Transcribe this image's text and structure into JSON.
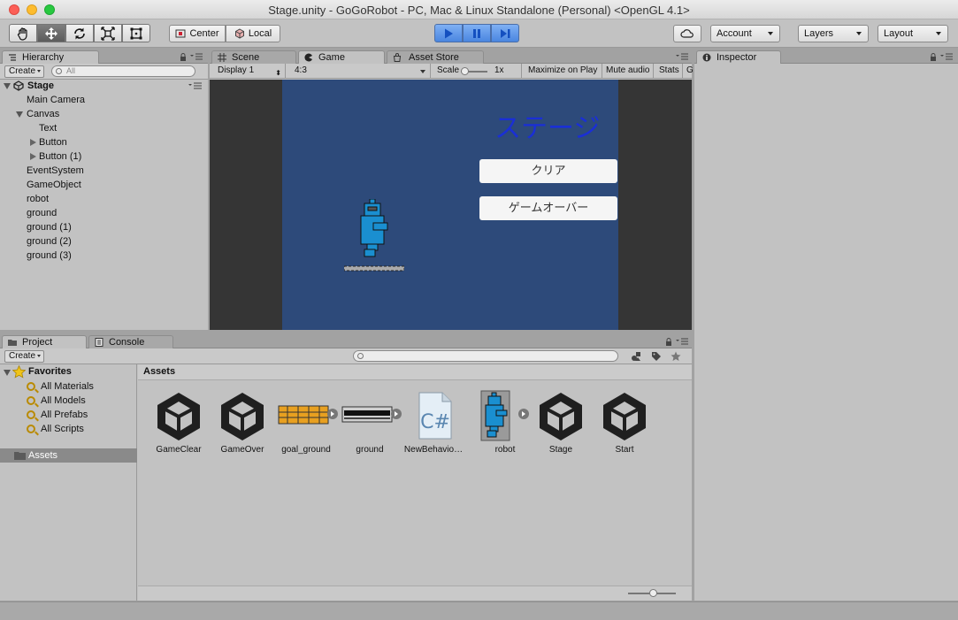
{
  "window": {
    "title": "Stage.unity - GoGoRobot - PC, Mac & Linux Standalone (Personal) <OpenGL 4.1>"
  },
  "toolbar": {
    "tools": [
      "hand-tool",
      "move-tool",
      "rotate-tool",
      "scale-tool",
      "rect-tool"
    ],
    "pivot_center": "Center",
    "pivot_local": "Local",
    "account": "Account",
    "layers": "Layers",
    "layout": "Layout",
    "colors": {
      "play_accent": "#4a86e0"
    }
  },
  "hierarchy": {
    "tab": "Hierarchy",
    "create": "Create",
    "search_placeholder": "All",
    "scene_name": "Stage",
    "items": [
      {
        "label": "Main Camera",
        "depth": 1
      },
      {
        "label": "Canvas",
        "depth": 1,
        "expanded": true
      },
      {
        "label": "Text",
        "depth": 2
      },
      {
        "label": "Button",
        "depth": 2,
        "collapsed": true
      },
      {
        "label": "Button (1)",
        "depth": 2,
        "collapsed": true
      },
      {
        "label": "EventSystem",
        "depth": 1
      },
      {
        "label": "GameObject",
        "depth": 1
      },
      {
        "label": "robot",
        "depth": 1
      },
      {
        "label": "ground",
        "depth": 1
      },
      {
        "label": "ground (1)",
        "depth": 1
      },
      {
        "label": "ground (2)",
        "depth": 1
      },
      {
        "label": "ground (3)",
        "depth": 1
      }
    ]
  },
  "center_tabs": {
    "scene": "Scene",
    "game": "Game",
    "asset_store": "Asset Store"
  },
  "game_view": {
    "display": "Display 1",
    "aspect": "4:3",
    "scale_label": "Scale",
    "scale_value": "1x",
    "maximize": "Maximize on Play",
    "mute": "Mute audio",
    "stats": "Stats",
    "stage_title": "ステージ",
    "clear_button": "クリア",
    "gameover_button": "ゲームオーバー",
    "colors": {
      "background": "#2d4a7a",
      "title": "#1a2fd6",
      "letterbox": "#353535"
    }
  },
  "inspector": {
    "tab": "Inspector"
  },
  "project": {
    "tab": "Project",
    "console_tab": "Console",
    "create": "Create",
    "favorites_label": "Favorites",
    "favorites": [
      "All Materials",
      "All Models",
      "All Prefabs",
      "All Scripts"
    ],
    "assets_folder": "Assets",
    "breadcrumb": "Assets",
    "assets": [
      {
        "label": "GameClear",
        "icon": "unity-scene-icon"
      },
      {
        "label": "GameOver",
        "icon": "unity-scene-icon"
      },
      {
        "label": "goal_ground",
        "icon": "sprite-icon"
      },
      {
        "label": "ground",
        "icon": "sprite-icon"
      },
      {
        "label": "NewBehavio…",
        "icon": "csharp-script-icon"
      },
      {
        "label": "robot",
        "icon": "sprite-icon"
      },
      {
        "label": "Stage",
        "icon": "unity-scene-icon"
      },
      {
        "label": "Start",
        "icon": "unity-scene-icon"
      }
    ]
  }
}
